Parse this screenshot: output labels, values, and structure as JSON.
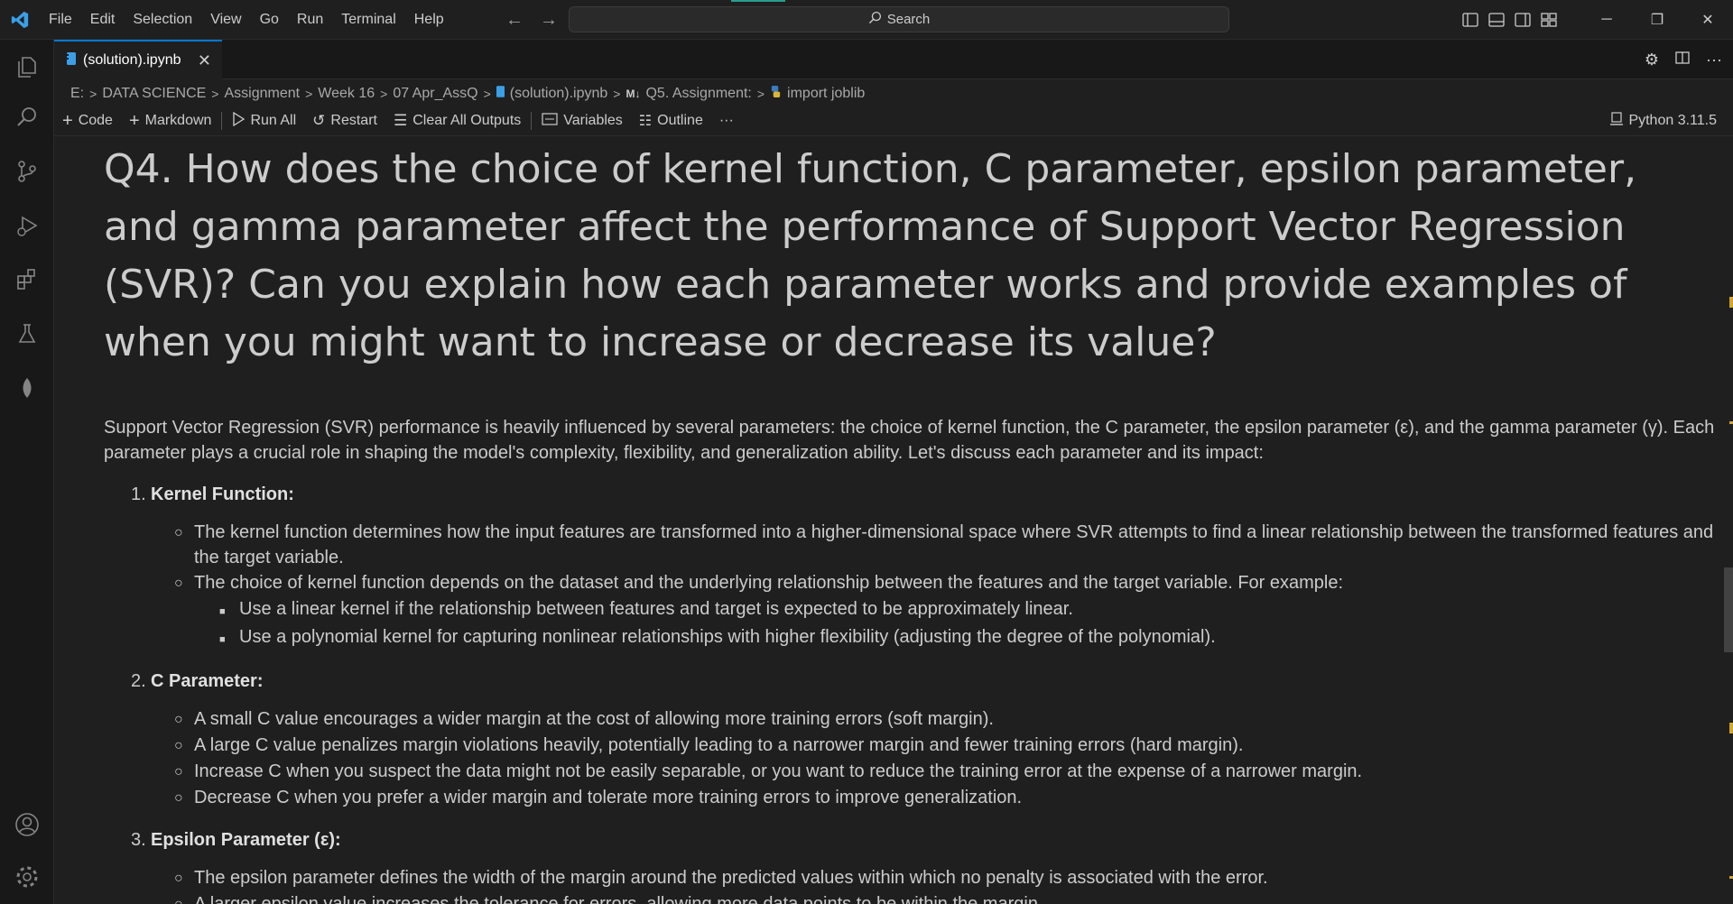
{
  "menu": [
    "File",
    "Edit",
    "Selection",
    "View",
    "Go",
    "Run",
    "Terminal",
    "Help"
  ],
  "search": {
    "label": "Search"
  },
  "tab": {
    "label": "(solution).ipynb",
    "close": "✕"
  },
  "breadcrumb": {
    "items": [
      "E:",
      "DATA SCIENCE",
      "Assignment",
      "Week 16",
      "07 Apr_AssQ",
      "(solution).ipynb",
      "Q5. Assignment:",
      "import joblib"
    ],
    "md_prefix": "M↓"
  },
  "toolbar": {
    "code": "Code",
    "markdown": "Markdown",
    "run_all": "Run All",
    "restart": "Restart",
    "clear_outputs": "Clear All Outputs",
    "variables": "Variables",
    "outline": "Outline",
    "more": "···",
    "kernel": "Python 3.11.5"
  },
  "content": {
    "heading": "Q4. How does the choice of kernel function, C parameter, epsilon parameter, and gamma parameter affect the performance of Support Vector Regression (SVR)? Can you explain how each parameter works and provide examples of when you might want to increase or decrease its value?",
    "intro": "Support Vector Regression (SVR) performance is heavily influenced by several parameters: the choice of kernel function, the C parameter, the epsilon parameter (ε), and the gamma parameter (γ). Each parameter plays a crucial role in shaping the model's complexity, flexibility, and generalization ability. Let's discuss each parameter and its impact:",
    "sections": [
      {
        "num": "1.",
        "title": "Kernel Function:",
        "items": [
          "The kernel function determines how the input features are transformed into a higher-dimensional space where SVR attempts to find a linear relationship between the transformed features and the target variable.",
          "The choice of kernel function depends on the dataset and the underlying relationship between the features and the target variable. For example:"
        ],
        "subitems": [
          "Use a linear kernel if the relationship between features and target is expected to be approximately linear.",
          "Use a polynomial kernel for capturing nonlinear relationships with higher flexibility (adjusting the degree of the polynomial)."
        ]
      },
      {
        "num": "2.",
        "title": "C Parameter:",
        "items": [
          "A small C value encourages a wider margin at the cost of allowing more training errors (soft margin).",
          "A large C value penalizes margin violations heavily, potentially leading to a narrower margin and fewer training errors (hard margin).",
          "Increase C when you suspect the data might not be easily separable, or you want to reduce the training error at the expense of a narrower margin.",
          "Decrease C when you prefer a wider margin and tolerate more training errors to improve generalization."
        ]
      },
      {
        "num": "3.",
        "title": "Epsilon Parameter (ε):",
        "items": [
          "The epsilon parameter defines the width of the margin around the predicted values within which no penalty is associated with the error.",
          "A larger epsilon value increases the tolerance for errors, allowing more data points to be within the margin."
        ]
      }
    ]
  },
  "colors": {
    "accent": "#0078d4",
    "ruler_mark": "#d4a72c",
    "background": "#1f1f1f"
  }
}
